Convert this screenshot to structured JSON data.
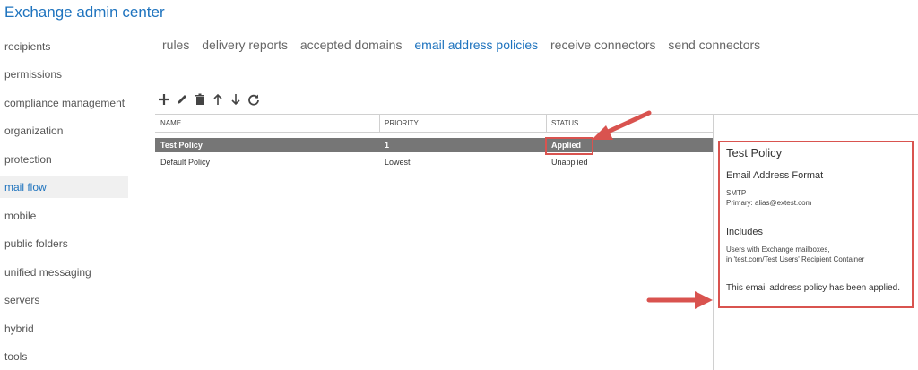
{
  "app": {
    "title": "Exchange admin center"
  },
  "sidebar": {
    "items": [
      {
        "label": "recipients"
      },
      {
        "label": "permissions"
      },
      {
        "label": "compliance management"
      },
      {
        "label": "organization"
      },
      {
        "label": "protection"
      },
      {
        "label": "mail flow",
        "active": true
      },
      {
        "label": "mobile"
      },
      {
        "label": "public folders"
      },
      {
        "label": "unified messaging"
      },
      {
        "label": "servers"
      },
      {
        "label": "hybrid"
      },
      {
        "label": "tools"
      }
    ]
  },
  "tabs": [
    {
      "label": "rules"
    },
    {
      "label": "delivery reports"
    },
    {
      "label": "accepted domains"
    },
    {
      "label": "email address policies",
      "active": true
    },
    {
      "label": "receive connectors"
    },
    {
      "label": "send connectors"
    }
  ],
  "toolbar": {
    "icons": [
      "add-icon",
      "edit-icon",
      "delete-icon",
      "move-up-icon",
      "move-down-icon",
      "refresh-icon"
    ]
  },
  "grid": {
    "columns": [
      "NAME",
      "PRIORITY",
      "STATUS"
    ],
    "rows": [
      {
        "name": "Test Policy",
        "priority": "1",
        "status": "Applied",
        "selected": true
      },
      {
        "name": "Default Policy",
        "priority": "Lowest",
        "status": "Unapplied",
        "selected": false
      }
    ]
  },
  "details": {
    "title": "Test Policy",
    "format_heading": "Email Address Format",
    "format_type": "SMTP",
    "format_primary": "Primary: alias@extest.com",
    "includes_heading": "Includes",
    "includes_line1": "Users with Exchange mailboxes,",
    "includes_line2": "in 'test.com/Test Users' Recipient Container",
    "status_message": "This email address policy has been applied."
  },
  "colors": {
    "accent": "#1e73be",
    "highlight": "#d9534f",
    "selected_row": "#767676"
  }
}
